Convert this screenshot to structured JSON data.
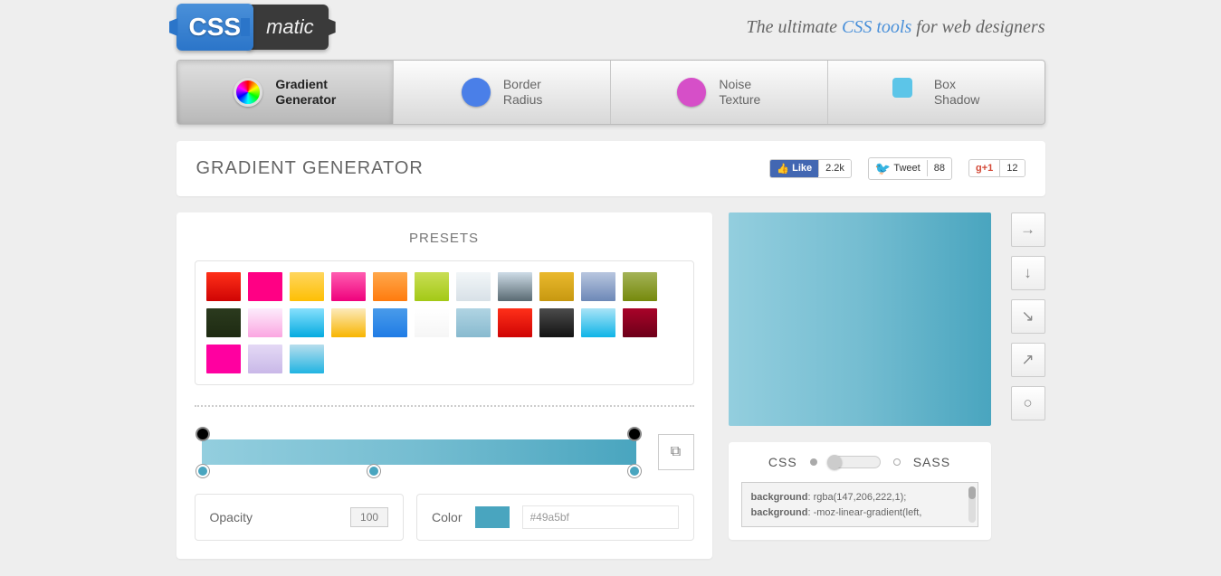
{
  "header": {
    "logo_css": "CSS",
    "logo_matic": "matic",
    "tagline_pre": "The ultimate ",
    "tagline_em": "CSS tools",
    "tagline_post": " for web designers"
  },
  "tabs": {
    "gradient_l1": "Gradient",
    "gradient_l2": "Generator",
    "border_l1": "Border",
    "border_l2": "Radius",
    "noise_l1": "Noise",
    "noise_l2": "Texture",
    "box_l1": "Box",
    "box_l2": "Shadow"
  },
  "page_title": "GRADIENT GENERATOR",
  "social": {
    "fb_label": "Like",
    "fb_count": "2.2k",
    "tw_label": "Tweet",
    "tw_count": "88",
    "gp_label": "+1",
    "gp_count": "12"
  },
  "presets_heading": "PRESETS",
  "presets": [
    "linear-gradient(to bottom,#ff3019,#cf0404)",
    "linear-gradient(to bottom,#ff0084,#ff0084)",
    "linear-gradient(to bottom,#ffd65e,#febf04)",
    "linear-gradient(to bottom,#ff5db1,#ef017c)",
    "linear-gradient(to bottom,#ffa84c,#ff7b0d)",
    "linear-gradient(to bottom,#c9de55,#a3c916)",
    "linear-gradient(to bottom,#f2f6f8,#d8e1e7)",
    "linear-gradient(to bottom,#cedce7,#596a72)",
    "linear-gradient(to bottom,#eab92d,#c79810)",
    "linear-gradient(to bottom,#b8c6df,#6d88b7)",
    "linear-gradient(to bottom,#a4b357,#75890c)",
    "linear-gradient(to bottom,#2b3a1e,#1e2b12)",
    "linear-gradient(to bottom,#fcecfc,#fba6e1)",
    "linear-gradient(to bottom,#87e0fd,#05abe0)",
    "linear-gradient(to bottom,#fceabb,#f8b500)",
    "linear-gradient(to bottom,#499bea,#207ce5)",
    "linear-gradient(to bottom,#ffffff,#f6f6f6)",
    "linear-gradient(to bottom,#b0d4e3,#88bacf)",
    "linear-gradient(to bottom,#ff3019,#cf0404)",
    "linear-gradient(to bottom,#4c4c4c,#131313)",
    "linear-gradient(to bottom,#a9e4f7,#0fb4e7)",
    "linear-gradient(to bottom,#a90329,#6d0019)",
    "linear-gradient(to bottom,#ff00a0,#ff00a0)",
    "linear-gradient(to bottom,#e4d9f5,#c9b8e8)",
    "linear-gradient(to bottom,#b7deed,#21b4e2)"
  ],
  "controls": {
    "opacity_label": "Opacity",
    "opacity_value": "100",
    "color_label": "Color",
    "color_hex": "#49a5bf"
  },
  "direction_icons": [
    "→",
    "↓",
    "↘",
    "↗",
    "○"
  ],
  "code_toggle": {
    "css": "CSS",
    "sass": "SASS"
  },
  "code_lines": [
    {
      "prop": "background",
      "val": ": rgba(147,206,222,1);"
    },
    {
      "prop": "background",
      "val": ": -moz-linear-gradient(left,"
    }
  ]
}
